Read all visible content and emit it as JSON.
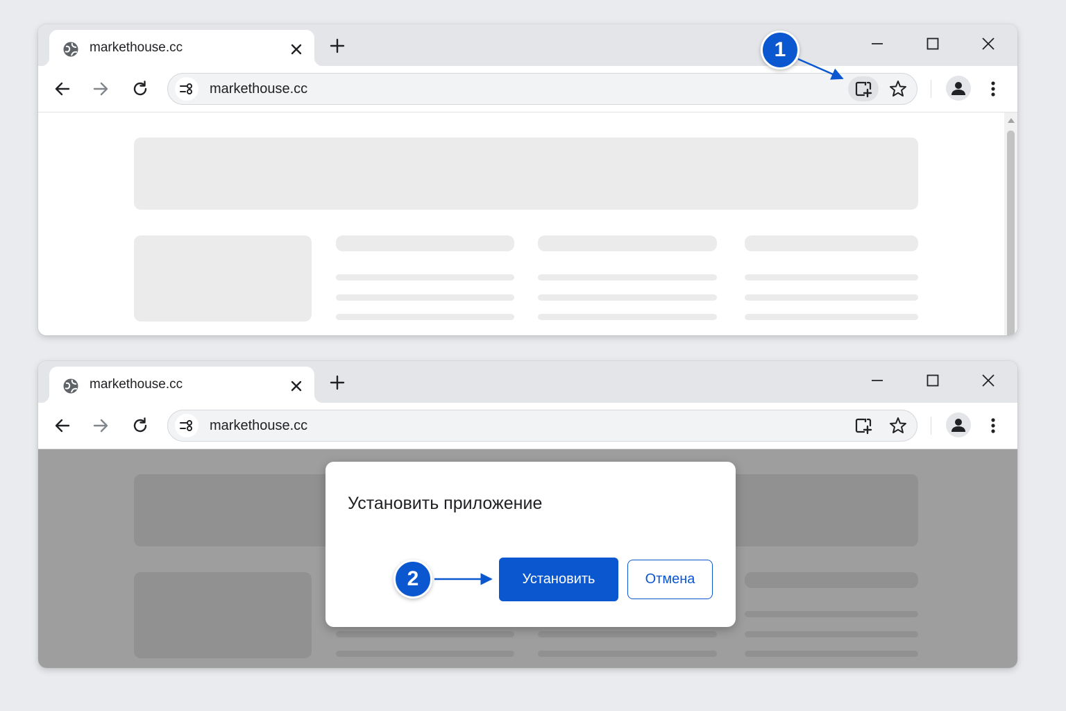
{
  "colors": {
    "accent": "#0b57d0",
    "page_background": "#e9ebee",
    "tab_strip": "#e3e5e8",
    "skeleton": "#ebebeb",
    "dim_overlay": "rgba(0,0,0,0.38)"
  },
  "windows": [
    {
      "tab_title": "markethouse.cc",
      "url": "markethouse.cc",
      "install_icon_highlighted": true
    },
    {
      "tab_title": "markethouse.cc",
      "url": "markethouse.cc",
      "install_icon_highlighted": false,
      "dialog": {
        "title": "Установить приложение",
        "install_label": "Установить",
        "cancel_label": "Отмена"
      }
    }
  ],
  "steps": [
    {
      "number": "1",
      "target": "install-app-icon"
    },
    {
      "number": "2",
      "target": "dialog-install-button"
    }
  ],
  "icons": [
    "globe-icon",
    "close-icon",
    "new-tab-icon",
    "minimize-icon",
    "maximize-icon",
    "close-window-icon",
    "back-icon",
    "forward-icon",
    "reload-icon",
    "site-settings-icon",
    "install-app-icon",
    "star-icon",
    "profile-icon",
    "menu-icon"
  ]
}
